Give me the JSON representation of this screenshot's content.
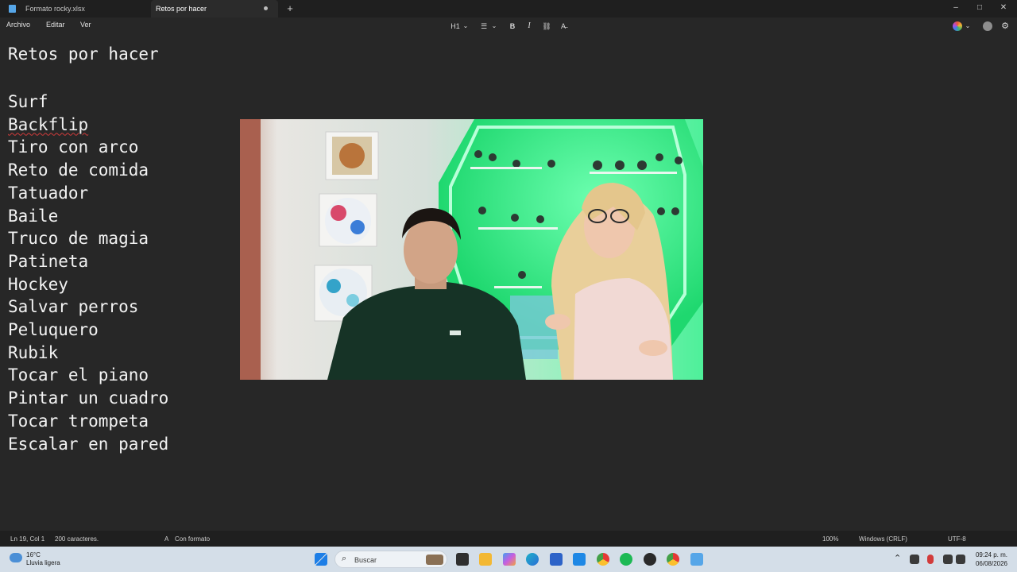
{
  "tabs": [
    {
      "label": "Formato rocky.xlsx",
      "active": false
    },
    {
      "label": "Retos por hacer",
      "active": true,
      "unsaved": true
    }
  ],
  "window_controls": {
    "new_tab": "+",
    "minimize": "–",
    "maximize": "□",
    "close": "✕"
  },
  "menu": {
    "file": "Archivo",
    "edit": "Editar",
    "view": "Ver"
  },
  "toolbar": {
    "heading": "H1",
    "heading_chevron": "⌄",
    "list": "☰",
    "list_chevron": "⌄",
    "bold": "B",
    "italic": "I",
    "link": "⛓",
    "clear_format": "A̶"
  },
  "toolbar_right": {
    "copilot_icon": "copilot-icon",
    "profile_icon": "profile-icon",
    "settings_icon": "gear-icon",
    "settings_glyph": "⚙"
  },
  "document": {
    "title": "Retos por hacer",
    "items": [
      "Surf",
      "Backflip",
      "Tiro con arco",
      "Reto de comida",
      "Tatuador",
      "Baile",
      "Truco de magia",
      "Patineta",
      "Hockey",
      "Salvar perros",
      "Peluquero",
      "Rubik",
      "Tocar el piano",
      "Pintar un cuadro",
      "Tocar trompeta",
      "Escalar en pared"
    ],
    "misspelled_index": 1
  },
  "statusbar": {
    "position": "Ln 19, Col 1",
    "chars": "200 caracteres.",
    "format_icon": "A",
    "format": "Con formato",
    "zoom": "100%",
    "line_ending": "Windows (CRLF)",
    "encoding": "UTF-8"
  },
  "taskbar": {
    "temp": "16°C",
    "condition": "Lluvia ligera",
    "search_placeholder": "Buscar",
    "tray_up": "⌃",
    "time": "09:24 p. m.",
    "date": "06/08/2026"
  },
  "colors": {
    "background": "#272727",
    "titlebar": "#1f1f1f",
    "text": "#f2f2f2",
    "spell_underline": "#d23b3b",
    "taskbar": "#d4dee8",
    "video_green": "#3ee88a"
  }
}
